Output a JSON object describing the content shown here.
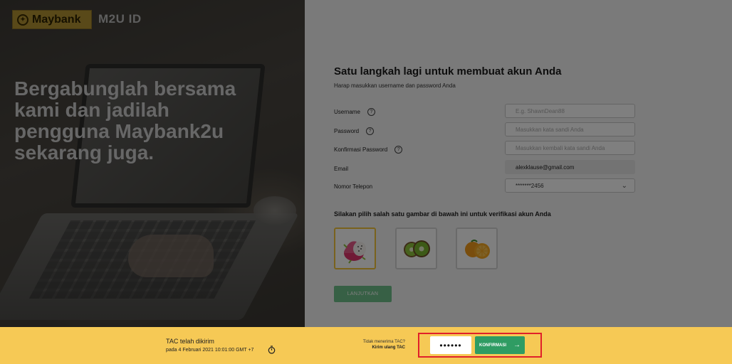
{
  "brand": {
    "name": "Maybank",
    "product": "M2U ID"
  },
  "hero": {
    "headline": "Bergabunglah bersama kami dan jadilah pengguna Maybank2u sekarang juga."
  },
  "form": {
    "title": "Satu langkah lagi untuk membuat akun Anda",
    "subtitle": "Harap masukkan username dan password Anda",
    "username": {
      "label": "Username",
      "placeholder": "E.g. ShawnDean88"
    },
    "password": {
      "label": "Password",
      "placeholder": "Masukkan kata sandi Anda"
    },
    "confirm_password": {
      "label": "Konfirmasi Password",
      "placeholder": "Masukkan kembali kata sandi Anda"
    },
    "email": {
      "label": "Email",
      "value": "alexklause@gmail.com"
    },
    "phone": {
      "label": "Nomor Telepon",
      "value": "*******2456"
    },
    "verify_prompt": "Silakan pilih salah satu gambar di bawah ini untuk verifikasi akun Anda",
    "verify_options": [
      "dragon-fruit",
      "kiwi",
      "orange"
    ],
    "selected_option": "dragon-fruit",
    "continue_label": "LANJUTKAN"
  },
  "tac_bar": {
    "title": "TAC telah dikirim",
    "sent_date": "pada 4 Februari 2021 10:01:00 GMT +7",
    "not_received": "Tidak menerima TAC?",
    "resend_label": "Kirim ulang TAC",
    "code_value": "••••••",
    "confirm_label": "KONFIRMASI"
  },
  "colors": {
    "brand_gold": "#b39232",
    "bar_yellow": "#f6c955",
    "confirm_green": "#2f9c63",
    "highlight_red": "#e0202a"
  }
}
